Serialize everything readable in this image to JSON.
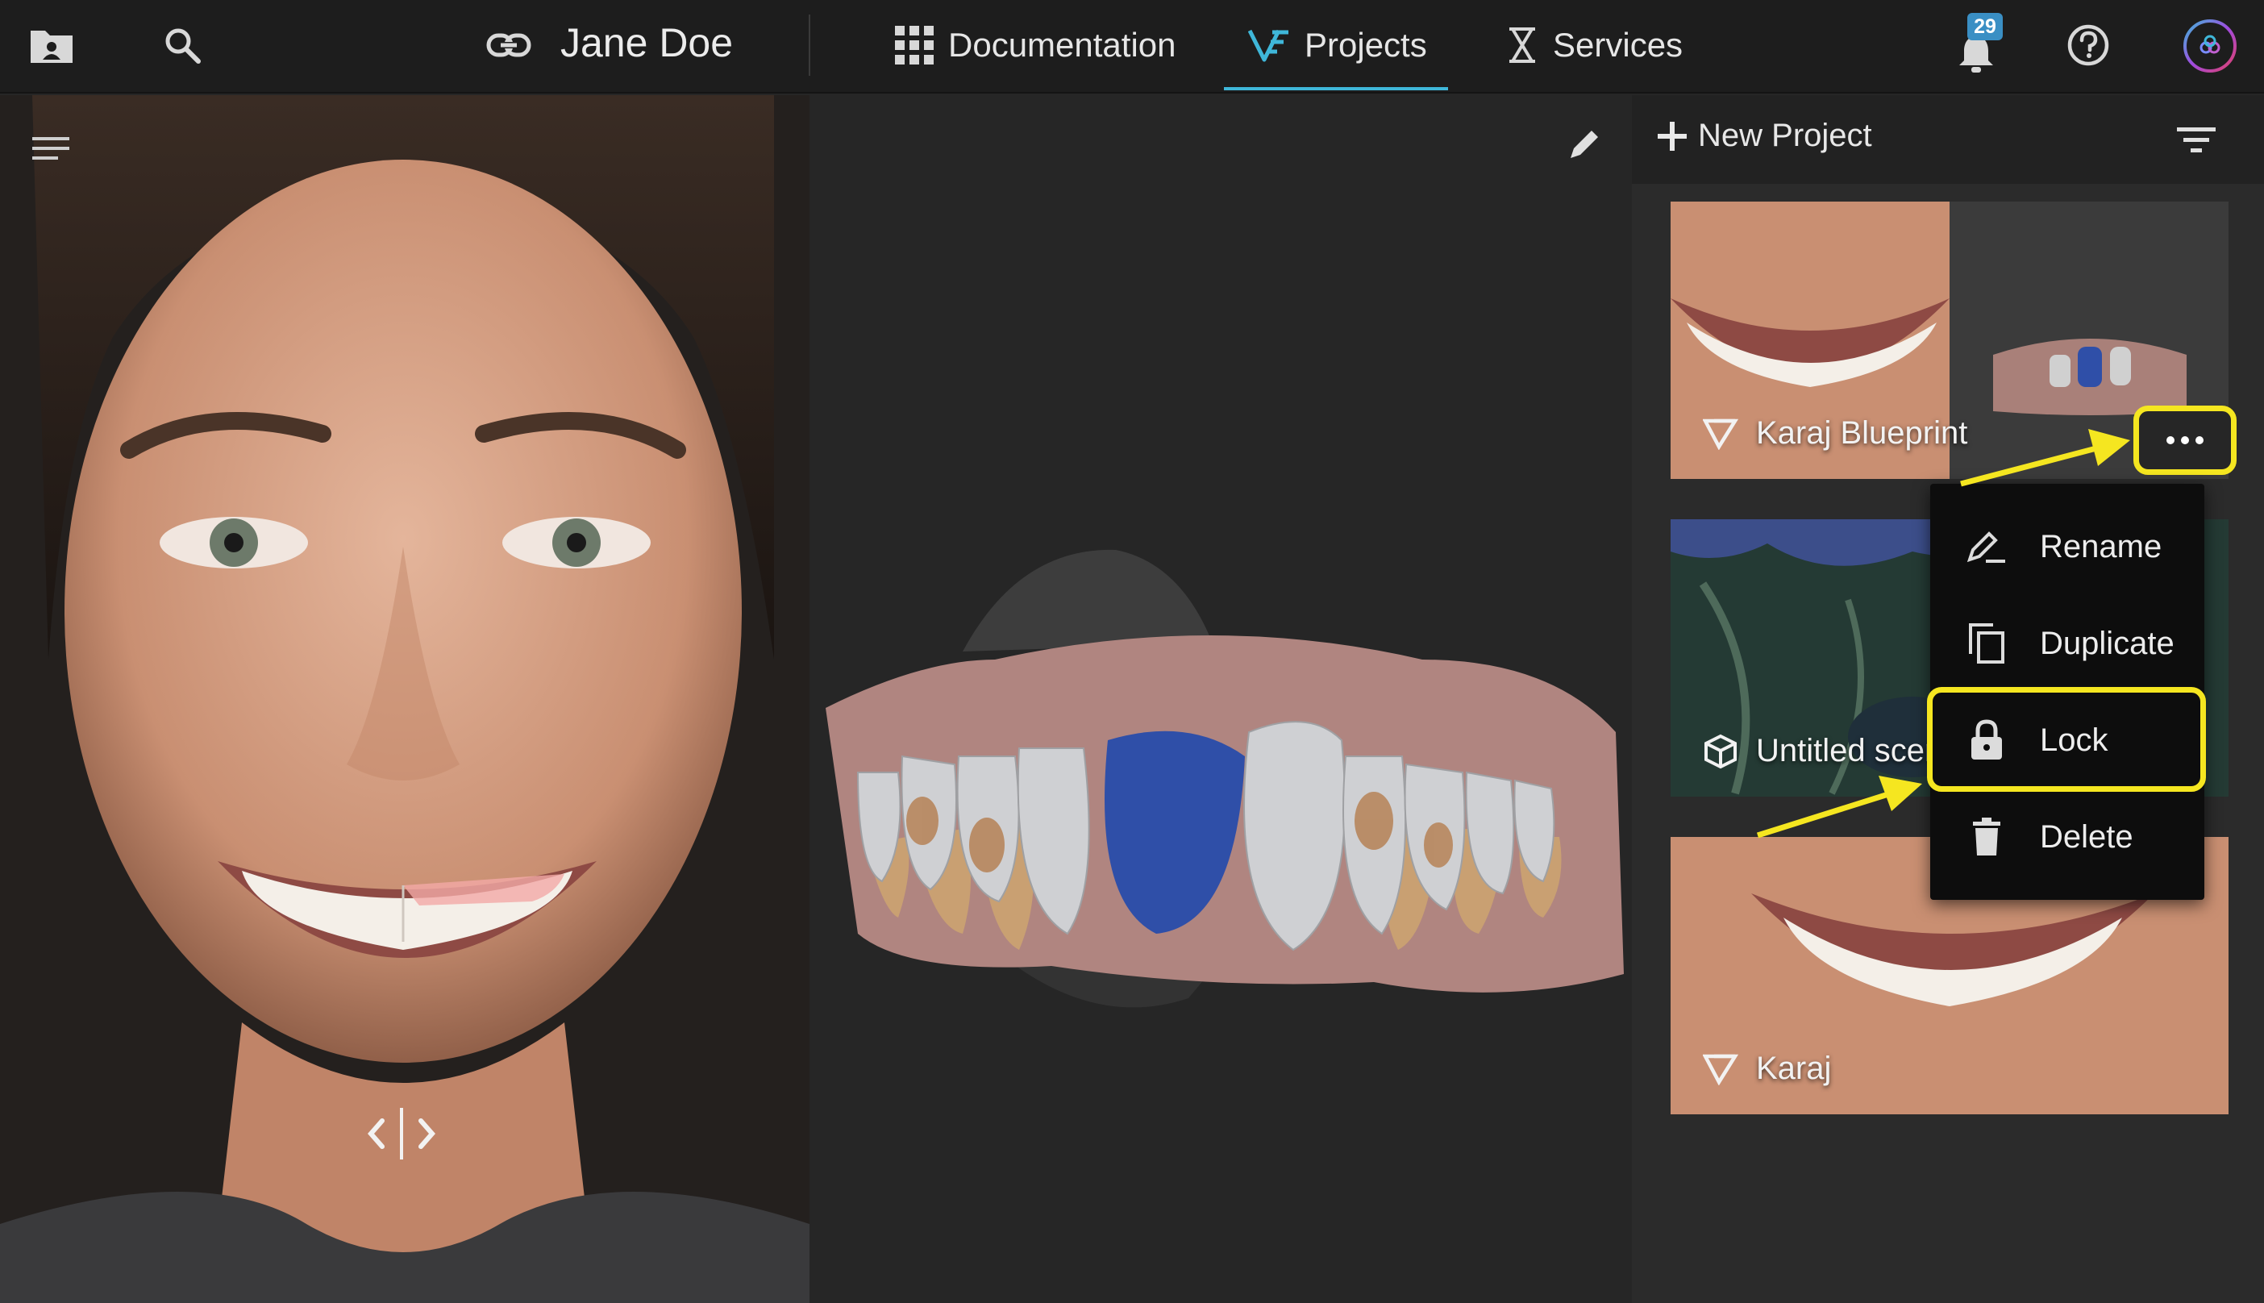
{
  "header": {
    "patient_name": "Jane Doe",
    "notification_count": "29",
    "nav": [
      {
        "label": "Documentation"
      },
      {
        "label": "Projects"
      },
      {
        "label": "Services"
      }
    ]
  },
  "sidebar": {
    "new_project_label": "New Project",
    "projects": [
      {
        "name": "Karaj Blueprint",
        "icon": "blueprint-icon"
      },
      {
        "name": "Untitled scen",
        "icon": "cube-icon"
      },
      {
        "name": "Karaj",
        "icon": "blueprint-icon"
      }
    ]
  },
  "context_menu": {
    "items": [
      {
        "label": "Rename",
        "icon": "rename-icon"
      },
      {
        "label": "Duplicate",
        "icon": "duplicate-icon"
      },
      {
        "label": "Lock",
        "icon": "lock-icon"
      },
      {
        "label": "Delete",
        "icon": "trash-icon"
      }
    ]
  },
  "colors": {
    "accent": "#3fb7d9",
    "highlight": "#f5e620",
    "badge": "#3a8fc4",
    "gum": "#b08580",
    "selected_tooth": "#2f4fa8"
  }
}
